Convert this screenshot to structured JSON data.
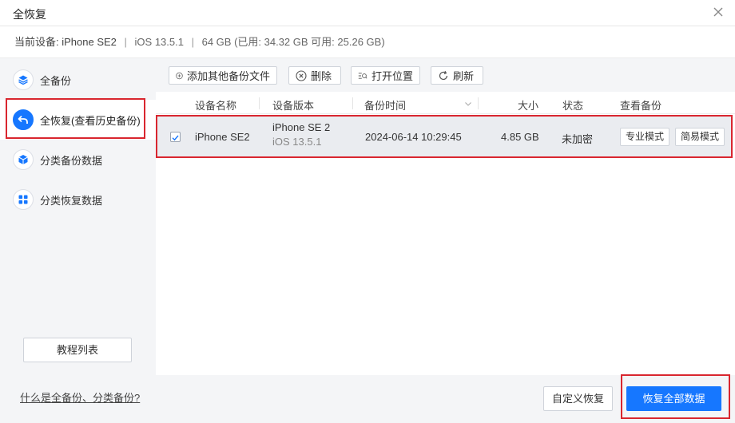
{
  "window": {
    "title": "全恢复"
  },
  "device": {
    "label": "当前设备: iPhone SE2",
    "ios": "iOS 13.5.1",
    "storage": "64 GB (已用: 34.32 GB 可用: 25.26 GB)",
    "separator": "|"
  },
  "sidebar": {
    "items": [
      {
        "label": "全备份",
        "icon": "layers-icon"
      },
      {
        "label": "全恢复(查看历史备份)",
        "icon": "undo-arrow-icon"
      },
      {
        "label": "分类备份数据",
        "icon": "cube-icon"
      },
      {
        "label": "分类恢复数据",
        "icon": "grid-icon"
      }
    ],
    "tutorial_button": "教程列表",
    "help_link": "什么是全备份、分类备份?"
  },
  "toolbar": {
    "add_label": "添加其他备份文件",
    "delete_label": "删除",
    "open_location_label": "打开位置",
    "refresh_label": "刷新"
  },
  "table": {
    "headers": {
      "device_name": "设备名称",
      "device_version": "设备版本",
      "backup_time": "备份时间",
      "size": "大小",
      "status": "状态",
      "view_backup": "查看备份"
    },
    "rows": [
      {
        "checked": true,
        "device_name": "iPhone SE2",
        "model": "iPhone SE 2",
        "ios": "iOS 13.5.1",
        "backup_time": "2024-06-14 10:29:45",
        "size": "4.85 GB",
        "status": "未加密",
        "pro_mode": "专业模式",
        "easy_mode": "简易模式"
      }
    ]
  },
  "footer": {
    "custom_restore": "自定义恢复",
    "restore_all": "恢复全部数据"
  },
  "colors": {
    "accent": "#1677ff",
    "highlight": "#d9262f"
  }
}
